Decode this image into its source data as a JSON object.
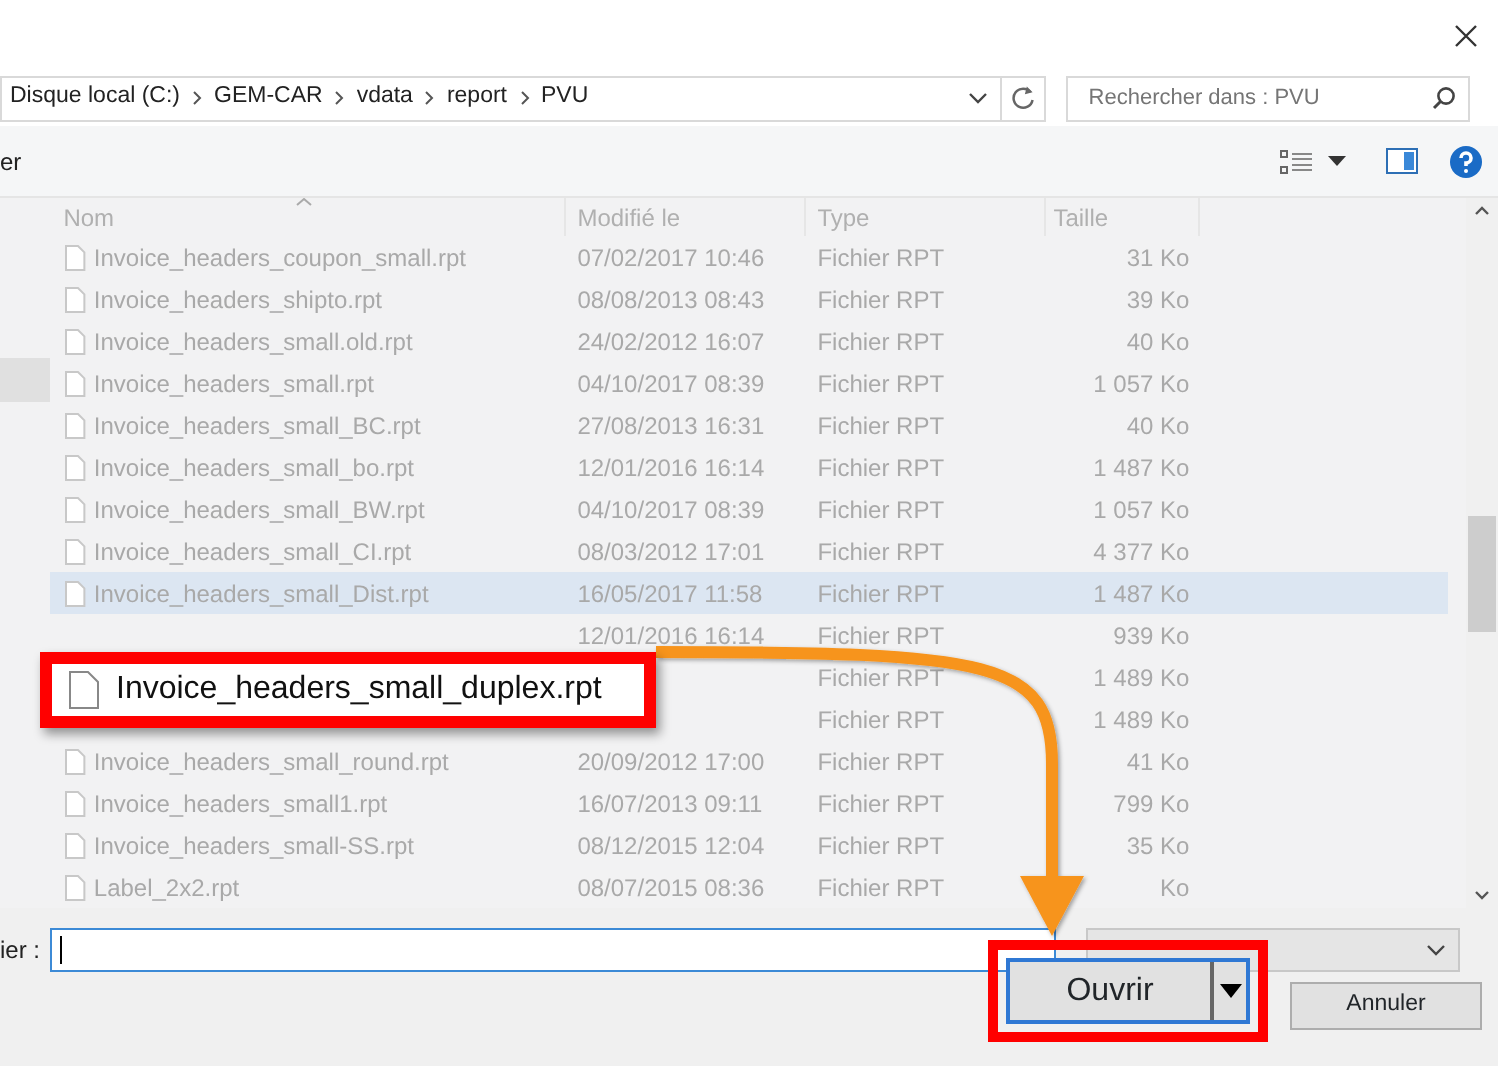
{
  "address": {
    "crumbs": [
      "Disque local (C:)",
      "GEM-CAR",
      "vdata",
      "report",
      "PVU"
    ]
  },
  "search": {
    "placeholder": "Rechercher dans : PVU"
  },
  "toolbar": {
    "label": "er"
  },
  "columns": [
    "Nom",
    "Modifié le",
    "Type",
    "Taille"
  ],
  "rows": [
    {
      "name": "Invoice_headers_coupon_small.rpt",
      "modified": "07/02/2017 10:46",
      "type": "Fichier RPT",
      "size": "31 Ko",
      "hovered": false
    },
    {
      "name": "Invoice_headers_shipto.rpt",
      "modified": "08/08/2013 08:43",
      "type": "Fichier RPT",
      "size": "39 Ko",
      "hovered": false
    },
    {
      "name": "Invoice_headers_small.old.rpt",
      "modified": "24/02/2012 16:07",
      "type": "Fichier RPT",
      "size": "40 Ko",
      "hovered": false
    },
    {
      "name": "Invoice_headers_small.rpt",
      "modified": "04/10/2017 08:39",
      "type": "Fichier RPT",
      "size": "1 057 Ko",
      "hovered": false
    },
    {
      "name": "Invoice_headers_small_BC.rpt",
      "modified": "27/08/2013 16:31",
      "type": "Fichier RPT",
      "size": "40 Ko",
      "hovered": false
    },
    {
      "name": "Invoice_headers_small_bo.rpt",
      "modified": "12/01/2016 16:14",
      "type": "Fichier RPT",
      "size": "1 487 Ko",
      "hovered": false
    },
    {
      "name": "Invoice_headers_small_BW.rpt",
      "modified": "04/10/2017 08:39",
      "type": "Fichier RPT",
      "size": "1 057 Ko",
      "hovered": false
    },
    {
      "name": "Invoice_headers_small_CI.rpt",
      "modified": "08/03/2012 17:01",
      "type": "Fichier RPT",
      "size": "4 377 Ko",
      "hovered": false
    },
    {
      "name": "Invoice_headers_small_Dist.rpt",
      "modified": "16/05/2017 11:58",
      "type": "Fichier RPT",
      "size": "1 487 Ko",
      "hovered": true
    },
    {
      "modified": "12/01/2016 16:14",
      "type": "Fichier RPT",
      "size": "939 Ko",
      "hovered": false
    },
    {
      "type": "Fichier RPT",
      "size": "1 489 Ko",
      "hovered": false
    },
    {
      "type": "Fichier RPT",
      "size": "1 489 Ko",
      "hovered": false
    },
    {
      "name": "Invoice_headers_small_round.rpt",
      "modified": "20/09/2012 17:00",
      "type": "Fichier RPT",
      "size": "41 Ko",
      "hovered": false
    },
    {
      "name": "Invoice_headers_small1.rpt",
      "modified": "16/07/2013 09:11",
      "type": "Fichier RPT",
      "size": "799 Ko",
      "hovered": false
    },
    {
      "name": "Invoice_headers_small-SS.rpt",
      "modified": "08/12/2015 12:04",
      "type": "Fichier RPT",
      "size": "35 Ko",
      "hovered": false
    },
    {
      "name": "Label_2x2.rpt",
      "modified": "08/07/2015 08:36",
      "type": "Fichier RPT",
      "size": "Ko",
      "hovered": false
    }
  ],
  "callout": {
    "text": "Invoice_headers_small_duplex.rpt"
  },
  "file_name": {
    "label": "ier :"
  },
  "buttons": [
    {
      "label": "Ouvrir",
      "kind": "split",
      "highlighted": true
    },
    {
      "label": "Annuler",
      "kind": "plain",
      "highlighted": false
    }
  ]
}
